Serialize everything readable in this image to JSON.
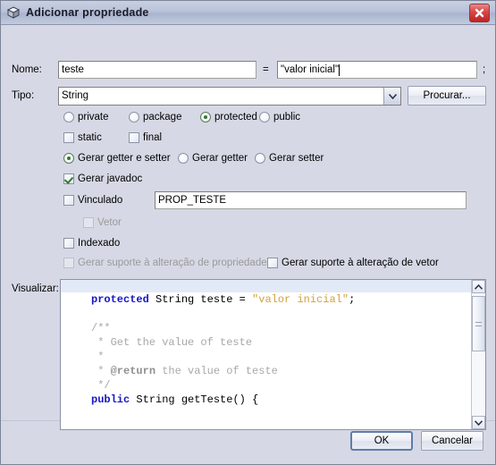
{
  "window": {
    "title": "Adicionar propriedade",
    "icon": "cube-icon",
    "close_label": "close-icon"
  },
  "form": {
    "name_label": "Nome:",
    "name_value": "teste",
    "equals_sign": "=",
    "init_value": "\"valor inicial\"",
    "semicolon": ";",
    "type_label": "Tipo:",
    "type_value": "String",
    "browse_label": "Procurar...",
    "access": {
      "options": [
        "private",
        "package",
        "protected",
        "public"
      ],
      "selected": "protected"
    },
    "modifiers": [
      {
        "label": "static",
        "checked": false
      },
      {
        "label": "final",
        "checked": false
      }
    ],
    "accessors": {
      "options": [
        "Gerar getter e setter",
        "Gerar getter",
        "Gerar setter"
      ],
      "selected": "Gerar getter e setter"
    },
    "javadoc": {
      "label": "Gerar javadoc",
      "checked": true
    },
    "bound": {
      "label": "Vinculado",
      "checked": false
    },
    "bound_value": "PROP_TESTE",
    "vector": {
      "label": "Vetor",
      "checked": false,
      "disabled": true
    },
    "indexed": {
      "label": "Indexado",
      "checked": false
    },
    "property_change_support": {
      "label": "Gerar suporte à alteração de propriedade",
      "checked": false,
      "disabled": true
    },
    "vector_change_support": {
      "label": "Gerar suporte à alteração de vetor",
      "checked": false,
      "disabled": false
    }
  },
  "preview": {
    "label": "Visualizar:",
    "lines": [
      {
        "segments": [
          {
            "t": "protected ",
            "c": "k"
          },
          {
            "t": "String teste = ",
            "c": "p"
          },
          {
            "t": "\"valor inicial\"",
            "c": "s"
          },
          {
            "t": ";",
            "c": "p"
          }
        ]
      },
      {
        "segments": [
          {
            "t": "",
            "c": "p"
          }
        ]
      },
      {
        "segments": [
          {
            "t": "/**",
            "c": "c"
          }
        ]
      },
      {
        "segments": [
          {
            "t": " * Get the value of teste",
            "c": "c"
          }
        ]
      },
      {
        "segments": [
          {
            "t": " *",
            "c": "c"
          }
        ]
      },
      {
        "segments": [
          {
            "t": " * ",
            "c": "c"
          },
          {
            "t": "@return",
            "c": "cb"
          },
          {
            "t": " the value of teste",
            "c": "c"
          }
        ]
      },
      {
        "segments": [
          {
            "t": " */",
            "c": "c"
          }
        ]
      },
      {
        "segments": [
          {
            "t": "public ",
            "c": "k"
          },
          {
            "t": "String getTeste() {",
            "c": "p"
          }
        ]
      }
    ],
    "scroll_up": "scroll-up-icon",
    "scroll_down": "scroll-down-icon"
  },
  "footer": {
    "ok_label": "OK",
    "cancel_label": "Cancelar"
  },
  "colors": {
    "keyword": "#1717c4",
    "string": "#d1a23c",
    "comment": "#a8a8a8",
    "window_bg": "#d6d9e5",
    "accent": "#5f7ca8"
  }
}
